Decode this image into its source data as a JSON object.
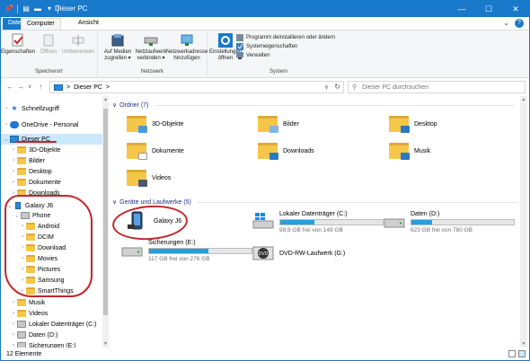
{
  "window": {
    "title": "Dieser PC",
    "controls": [
      "minimize",
      "maximize",
      "close"
    ]
  },
  "quick_access_toolbar": [
    "pin-icon",
    "properties-icon",
    "new-folder-icon",
    "dropdown-icon"
  ],
  "tabs": {
    "file": "Datei",
    "computer": "Computer",
    "view": "Ansicht"
  },
  "ribbon": {
    "location_group": {
      "label": "Speicherort",
      "properties": "Eigenschaften",
      "open": "Öffnen",
      "rename": "Umbenennen"
    },
    "network_group": {
      "label": "Netzwerk",
      "access_media": "Auf Medien\nzugreifen ▾",
      "map_drive": "Netzlaufwerk\nverbinden ▾",
      "add_location": "Netzwerkadresse\nhinzufügen"
    },
    "system_group": {
      "label": "System",
      "settings": "Einstellungen\nöffnen",
      "uninstall": "Programm deinstallieren oder ändern",
      "sysprops": "Systemeigenschaften",
      "manage": "Verwalten"
    }
  },
  "address_bar": {
    "path_label": "Dieser PC",
    "separator": ">",
    "search_placeholder": "Dieser PC durchsuchen"
  },
  "nav_pane": {
    "items": [
      {
        "label": "Schnellzugriff",
        "icon": "star-icon",
        "chev": ">"
      },
      {
        "label": "OneDrive - Personal",
        "icon": "onedrive-icon",
        "chev": ">"
      },
      {
        "label": "Dieser PC",
        "icon": "pc-icon",
        "chev": "v"
      },
      {
        "label": "3D-Objekte",
        "icon": "folder-icon",
        "chev": ">"
      },
      {
        "label": "Bilder",
        "icon": "folder-icon",
        "chev": ">"
      },
      {
        "label": "Desktop",
        "icon": "folder-icon",
        "chev": ">"
      },
      {
        "label": "Dokumente",
        "icon": "folder-icon",
        "chev": ">"
      },
      {
        "label": "Downloads",
        "icon": "folder-icon",
        "chev": ">"
      },
      {
        "label": "Galaxy J6",
        "icon": "phone-icon",
        "chev": "v"
      },
      {
        "label": "Phone",
        "icon": "drive-icon",
        "chev": "v"
      },
      {
        "label": "Android",
        "icon": "folder-icon",
        "chev": ">"
      },
      {
        "label": "DCIM",
        "icon": "folder-icon",
        "chev": ">"
      },
      {
        "label": "Download",
        "icon": "folder-icon",
        "chev": ">"
      },
      {
        "label": "Movies",
        "icon": "folder-icon",
        "chev": ">"
      },
      {
        "label": "Pictures",
        "icon": "folder-icon",
        "chev": ">"
      },
      {
        "label": "Samsung",
        "icon": "folder-icon",
        "chev": ">"
      },
      {
        "label": "SmartThings",
        "icon": "folder-icon",
        "chev": ">"
      },
      {
        "label": "Musik",
        "icon": "folder-icon",
        "chev": ">"
      },
      {
        "label": "Videos",
        "icon": "folder-icon",
        "chev": ">"
      },
      {
        "label": "Lokaler Datenträger (C:)",
        "icon": "drive-icon",
        "chev": ">"
      },
      {
        "label": "Daten (D:)",
        "icon": "drive-icon",
        "chev": ">"
      },
      {
        "label": "Sicherungen (E:)",
        "icon": "drive-icon",
        "chev": ">"
      }
    ]
  },
  "content": {
    "folders_header": "Ordner (7)",
    "folders": [
      {
        "name": "3D-Objekte",
        "icon": "3d-objects-folder-icon"
      },
      {
        "name": "Bilder",
        "icon": "pictures-folder-icon"
      },
      {
        "name": "Desktop",
        "icon": "desktop-folder-icon"
      },
      {
        "name": "Dokumente",
        "icon": "documents-folder-icon"
      },
      {
        "name": "Downloads",
        "icon": "downloads-folder-icon"
      },
      {
        "name": "Musik",
        "icon": "music-folder-icon"
      },
      {
        "name": "Videos",
        "icon": "videos-folder-icon"
      }
    ],
    "devices_header": "Geräte und Laufwerke (5)",
    "devices": [
      {
        "name": "Galaxy J6",
        "icon": "phone-icon"
      },
      {
        "name": "Lokaler Datenträger (C:)",
        "free": "99,9 GB frei von 149 GB",
        "used_fraction": 0.33,
        "icon": "windows-drive-icon"
      },
      {
        "name": "Daten (D:)",
        "free": "623 GB frei von 780 GB",
        "used_fraction": 0.2,
        "icon": "drive-icon"
      },
      {
        "name": "Sicherungen (E:)",
        "free": "117 GB frei von 276 GB",
        "used_fraction": 0.58,
        "icon": "drive-icon"
      },
      {
        "name": "DVD-RW-Laufwerk (G:)",
        "icon": "dvd-drive-icon"
      }
    ]
  },
  "status_bar": {
    "count": "12 Elemente"
  },
  "colors": {
    "accent": "#1979ca",
    "selection": "#cce8ff",
    "bar_fill": "#26a0da",
    "annotation": "#c1272d"
  }
}
